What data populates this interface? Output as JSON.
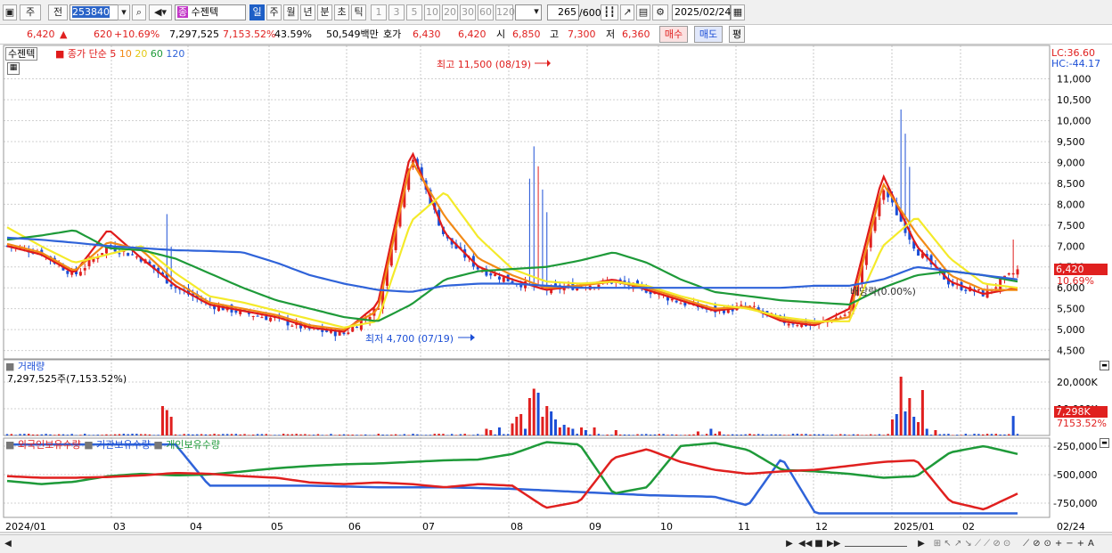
{
  "toolbar": {
    "type_label": "주",
    "prev_label": "전",
    "code": "253840",
    "stock_badge": "종",
    "stock_name": "수젠텍",
    "periods": [
      "일",
      "주",
      "월",
      "년",
      "분",
      "초",
      "틱"
    ],
    "selected_period": "일",
    "intervals": [
      "1",
      "3",
      "5",
      "10",
      "20",
      "30",
      "60",
      "120"
    ],
    "count": "265",
    "count_total": "/600",
    "date": "2025/02/24"
  },
  "quote": {
    "price": "6,420",
    "change": "620",
    "change_pct": "+10.69%",
    "volume": "7,297,525",
    "volume_pct": "7,153.52%",
    "turnover_pct": "43.59%",
    "amount": "50,549백만",
    "hoga_label": "호가",
    "hoga1": "6,430",
    "hoga2": "6,420",
    "open_label": "시",
    "open": "6,850",
    "high_label": "고",
    "high": "7,300",
    "low_label": "저",
    "low": "6,360",
    "buy_label": "매수",
    "sell_label": "매도",
    "eval_label": "평"
  },
  "legend": {
    "name": "수젠텍",
    "ma_label": "종가 단순",
    "ma_periods": [
      "5",
      "10",
      "20",
      "60",
      "120"
    ]
  },
  "indicators": {
    "lc": "LC:36.60",
    "hc": "HC:-44.17",
    "price_tag": "6,420",
    "pct_tag": "10.69%",
    "vol_tag": "7,298K",
    "vol_pct_tag": "7153.52%",
    "dividend": "배당락(0.00%)",
    "high_note": "최고 11,500 (08/19)",
    "low_note": "최저 4,700 (07/19)"
  },
  "volume_panel": {
    "title": "거래량",
    "value": "7,297,525주(7,153.52%)",
    "ticks": [
      "20,000K",
      "10,000K"
    ]
  },
  "holders_panel": {
    "foreign": "외국인보유수량",
    "inst": "기관보유수량",
    "individual": "개인보유수량",
    "ticks": [
      "-250,000",
      "-500,000",
      "-750,000"
    ]
  },
  "x_axis": {
    "labels": [
      "2024/01",
      "03",
      "04",
      "05",
      "06",
      "07",
      "08",
      "09",
      "10",
      "11",
      "12",
      "2025/01",
      "02"
    ],
    "right_label": "02/24"
  },
  "colors": {
    "up": "#e0201f",
    "down": "#1c4fd6",
    "ma5": "#e01b1b",
    "ma10": "#f28a16",
    "ma20": "#f4ea2a",
    "ma60": "#1e9a39",
    "ma120": "#2f63d9"
  },
  "chart_data": {
    "type": "line",
    "title": "",
    "xlabel": "",
    "ylabel": "",
    "ylim": [
      4300,
      11800
    ],
    "price_ticks": [
      4500,
      5000,
      5500,
      6000,
      6500,
      7000,
      7500,
      8000,
      8500,
      9000,
      9500,
      10000,
      10500,
      11000
    ],
    "dates": [
      "2024/01",
      "02",
      "03",
      "04",
      "05",
      "06",
      "07",
      "08",
      "09",
      "10",
      "11",
      "12",
      "2025/01",
      "02",
      "02/24"
    ],
    "series": [
      {
        "name": "종가",
        "values": [
          7000,
          6850,
          6300,
          7000,
          6700,
          6000,
          5600,
          5400,
          5250,
          5000,
          4900,
          5500,
          9200,
          7200,
          6450,
          6150,
          5950,
          6050,
          6150,
          5950,
          5650,
          5450,
          5550,
          5200,
          5100,
          5400,
          8400,
          6900,
          6100,
          5850,
          6420
        ]
      },
      {
        "name": "5",
        "values": [
          7000,
          6800,
          6350,
          7400,
          6700,
          6050,
          5600,
          5450,
          5300,
          5050,
          4950,
          5600,
          9300,
          7300,
          6500,
          6200,
          5950,
          6050,
          6200,
          5950,
          5700,
          5450,
          5550,
          5200,
          5100,
          5500,
          8700,
          7000,
          6150,
          5850,
          6000
        ]
      },
      {
        "name": "10",
        "values": [
          7050,
          6850,
          6400,
          7100,
          6900,
          6150,
          5650,
          5500,
          5350,
          5100,
          5000,
          5450,
          9050,
          7700,
          6700,
          6300,
          6000,
          6050,
          6150,
          6000,
          5750,
          5500,
          5550,
          5250,
          5150,
          5300,
          8500,
          7300,
          6300,
          5950,
          5950
        ]
      },
      {
        "name": "20",
        "values": [
          7450,
          7000,
          6600,
          6800,
          7000,
          6350,
          5800,
          5650,
          5450,
          5250,
          5050,
          5200,
          7600,
          8300,
          7200,
          6450,
          6150,
          6100,
          6150,
          6050,
          5800,
          5600,
          5500,
          5300,
          5200,
          5200,
          7000,
          7700,
          6700,
          6100,
          6000
        ]
      },
      {
        "name": "60",
        "values": [
          7150,
          7250,
          7380,
          6950,
          6900,
          6700,
          6350,
          6000,
          5700,
          5500,
          5300,
          5200,
          5600,
          6200,
          6400,
          6450,
          6500,
          6650,
          6850,
          6600,
          6200,
          5900,
          5800,
          5700,
          5650,
          5600,
          6000,
          6300,
          6400,
          6300,
          6150
        ]
      },
      {
        "name": "120",
        "values": [
          7200,
          7150,
          7080,
          7000,
          6950,
          6900,
          6880,
          6850,
          6600,
          6300,
          6100,
          5950,
          5900,
          6050,
          6100,
          6100,
          6050,
          6000,
          6000,
          6000,
          6000,
          6000,
          6000,
          6000,
          6050,
          6050,
          6200,
          6500,
          6400,
          6300,
          6200
        ]
      }
    ],
    "volume": {
      "ylim": [
        0,
        25000
      ],
      "bars": [
        {
          "i": 36,
          "v": 11000,
          "up": true
        },
        {
          "i": 37,
          "v": 9500,
          "up": true
        },
        {
          "i": 38,
          "v": 7000,
          "up": true
        },
        {
          "i": 111,
          "v": 2500,
          "up": true
        },
        {
          "i": 112,
          "v": 2000,
          "up": true
        },
        {
          "i": 114,
          "v": 3000,
          "up": false
        },
        {
          "i": 117,
          "v": 4500,
          "up": true
        },
        {
          "i": 118,
          "v": 7000,
          "up": true
        },
        {
          "i": 119,
          "v": 8000,
          "up": true
        },
        {
          "i": 120,
          "v": 2500,
          "up": false
        },
        {
          "i": 121,
          "v": 14000,
          "up": true
        },
        {
          "i": 122,
          "v": 17500,
          "up": true
        },
        {
          "i": 123,
          "v": 16000,
          "up": false
        },
        {
          "i": 124,
          "v": 7000,
          "up": true
        },
        {
          "i": 125,
          "v": 11000,
          "up": true
        },
        {
          "i": 126,
          "v": 9000,
          "up": false
        },
        {
          "i": 127,
          "v": 6000,
          "up": false
        },
        {
          "i": 128,
          "v": 3000,
          "up": true
        },
        {
          "i": 129,
          "v": 4000,
          "up": false
        },
        {
          "i": 130,
          "v": 3000,
          "up": true
        },
        {
          "i": 131,
          "v": 2500,
          "up": false
        },
        {
          "i": 133,
          "v": 3000,
          "up": true
        },
        {
          "i": 134,
          "v": 2000,
          "up": false
        },
        {
          "i": 136,
          "v": 3000,
          "up": true
        },
        {
          "i": 141,
          "v": 2000,
          "up": true
        },
        {
          "i": 160,
          "v": 1500,
          "up": true
        },
        {
          "i": 163,
          "v": 2500,
          "up": false
        },
        {
          "i": 165,
          "v": 1500,
          "up": true
        },
        {
          "i": 205,
          "v": 6000,
          "up": true
        },
        {
          "i": 206,
          "v": 8000,
          "up": false
        },
        {
          "i": 207,
          "v": 22000,
          "up": true
        },
        {
          "i": 208,
          "v": 9000,
          "up": false
        },
        {
          "i": 209,
          "v": 14000,
          "up": true
        },
        {
          "i": 210,
          "v": 7000,
          "up": false
        },
        {
          "i": 211,
          "v": 5000,
          "up": true
        },
        {
          "i": 212,
          "v": 17000,
          "up": true
        },
        {
          "i": 213,
          "v": 2500,
          "up": false
        },
        {
          "i": 215,
          "v": 2000,
          "up": true
        },
        {
          "i": 233,
          "v": 7300,
          "up": false
        }
      ]
    }
  }
}
